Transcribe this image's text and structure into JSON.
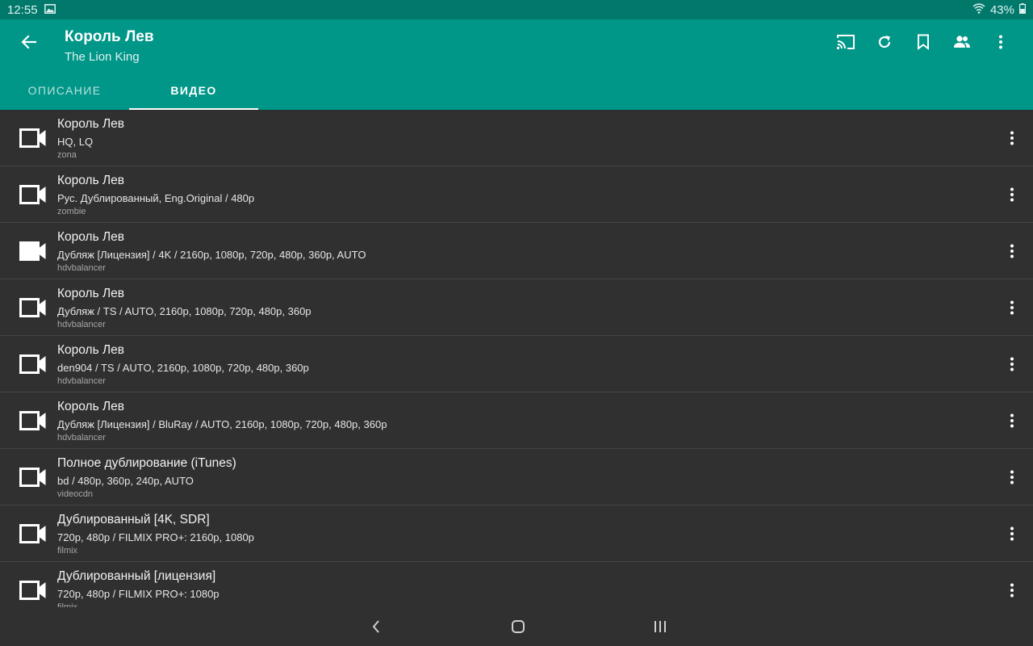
{
  "status": {
    "time": "12:55",
    "battery": "43%"
  },
  "header": {
    "title": "Король Лев",
    "subtitle": "The Lion King"
  },
  "tabs": [
    {
      "label": "ОПИСАНИЕ"
    },
    {
      "label": "ВИДЕО"
    }
  ],
  "items": [
    {
      "title": "Король Лев",
      "details": "HQ, LQ",
      "source": "zona"
    },
    {
      "title": "Король Лев",
      "details": "Рус. Дублированный, Eng.Original / 480p",
      "source": "zombie"
    },
    {
      "title": "Король Лев",
      "details": "Дубляж [Лицензия] / 4K / 2160p, 1080p, 720p, 480p, 360p, AUTO",
      "source": "hdvbalancer"
    },
    {
      "title": "Король Лев",
      "details": "Дубляж / TS / AUTO, 2160p, 1080p, 720p, 480p, 360p",
      "source": "hdvbalancer"
    },
    {
      "title": "Король Лев",
      "details": "den904 / TS / AUTO, 2160p, 1080p, 720p, 480p, 360p",
      "source": "hdvbalancer"
    },
    {
      "title": "Король Лев",
      "details": "Дубляж [Лицензия] / BluRay / AUTO, 2160p, 1080p, 720p, 480p, 360p",
      "source": "hdvbalancer"
    },
    {
      "title": "Полное дублирование (iTunes)",
      "details": "bd / 480p, 360p, 240p, AUTO",
      "source": "videocdn"
    },
    {
      "title": "Дублированный [4K, SDR]",
      "details": "720p, 480p / FILMIX PRO+: 2160p, 1080p",
      "source": "filmix"
    },
    {
      "title": "Дублированный [лицензия]",
      "details": "720p, 480p / FILMIX PRO+: 1080p",
      "source": "filmix"
    }
  ]
}
